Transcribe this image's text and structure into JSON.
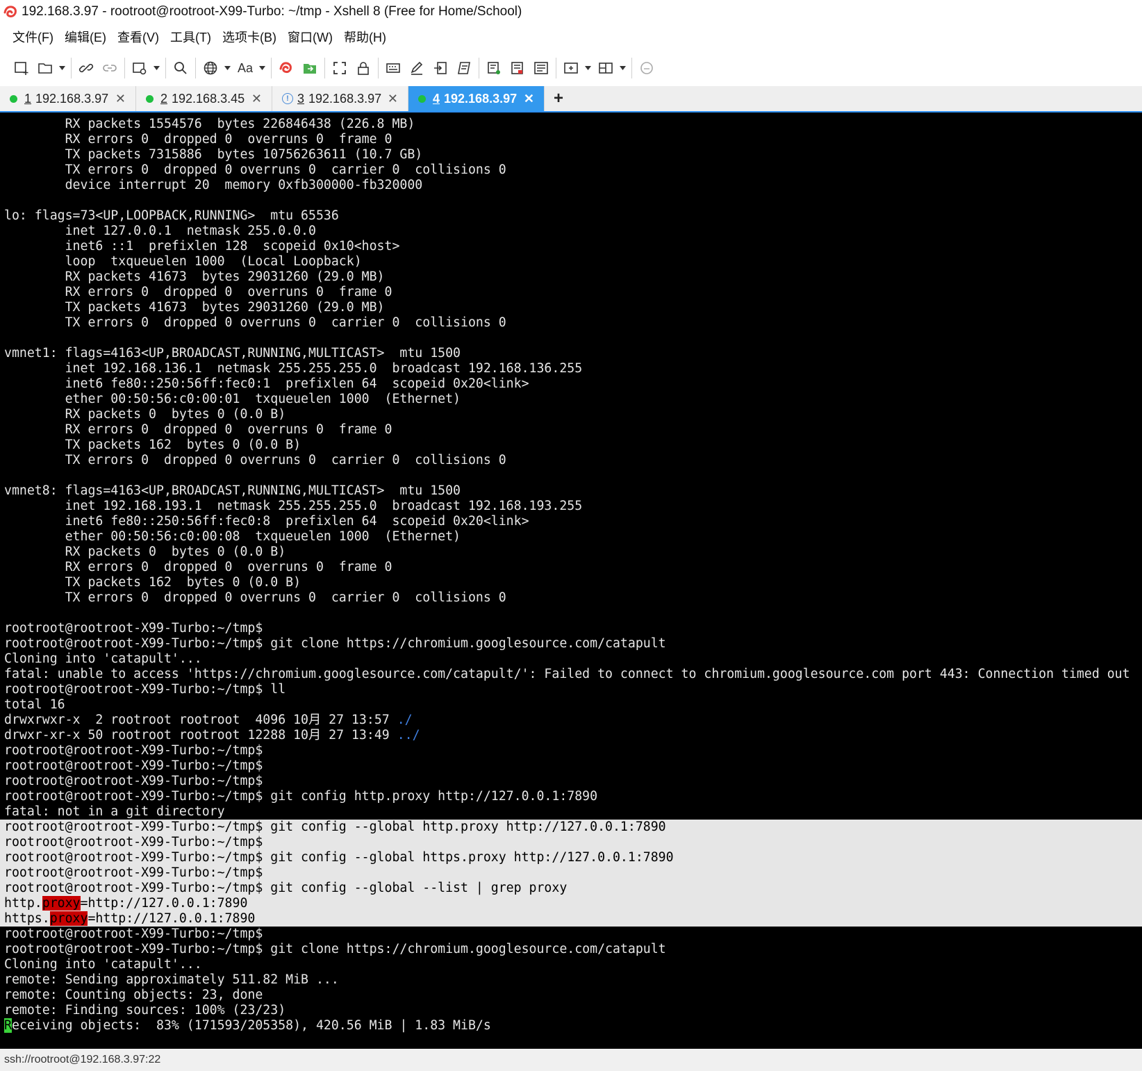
{
  "window": {
    "title": "192.168.3.97 - rootroot@rootroot-X99-Turbo: ~/tmp - Xshell 8 (Free for Home/School)"
  },
  "menu": [
    "文件(F)",
    "编辑(E)",
    "查看(V)",
    "工具(T)",
    "选项卡(B)",
    "窗口(W)",
    "帮助(H)"
  ],
  "toolbar": {
    "font_label": "Aa"
  },
  "tabs": [
    {
      "num": "1",
      "label": "192.168.3.97",
      "status": "connected",
      "active": false
    },
    {
      "num": "2",
      "label": "192.168.3.45",
      "status": "connected",
      "active": false
    },
    {
      "num": "3",
      "label": "192.168.3.97",
      "status": "warning",
      "active": false
    },
    {
      "num": "4",
      "label": "192.168.3.97",
      "status": "connected",
      "active": true
    }
  ],
  "tab_add_label": "+",
  "terminal": {
    "lines": [
      "        RX packets 1554576  bytes 226846438 (226.8 MB)",
      "        RX errors 0  dropped 0  overruns 0  frame 0",
      "        TX packets 7315886  bytes 10756263611 (10.7 GB)",
      "        TX errors 0  dropped 0 overruns 0  carrier 0  collisions 0",
      "        device interrupt 20  memory 0xfb300000-fb320000",
      "",
      "lo: flags=73<UP,LOOPBACK,RUNNING>  mtu 65536",
      "        inet 127.0.0.1  netmask 255.0.0.0",
      "        inet6 ::1  prefixlen 128  scopeid 0x10<host>",
      "        loop  txqueuelen 1000  (Local Loopback)",
      "        RX packets 41673  bytes 29031260 (29.0 MB)",
      "        RX errors 0  dropped 0  overruns 0  frame 0",
      "        TX packets 41673  bytes 29031260 (29.0 MB)",
      "        TX errors 0  dropped 0 overruns 0  carrier 0  collisions 0",
      "",
      "vmnet1: flags=4163<UP,BROADCAST,RUNNING,MULTICAST>  mtu 1500",
      "        inet 192.168.136.1  netmask 255.255.255.0  broadcast 192.168.136.255",
      "        inet6 fe80::250:56ff:fec0:1  prefixlen 64  scopeid 0x20<link>",
      "        ether 00:50:56:c0:00:01  txqueuelen 1000  (Ethernet)",
      "        RX packets 0  bytes 0 (0.0 B)",
      "        RX errors 0  dropped 0  overruns 0  frame 0",
      "        TX packets 162  bytes 0 (0.0 B)",
      "        TX errors 0  dropped 0 overruns 0  carrier 0  collisions 0",
      "",
      "vmnet8: flags=4163<UP,BROADCAST,RUNNING,MULTICAST>  mtu 1500",
      "        inet 192.168.193.1  netmask 255.255.255.0  broadcast 192.168.193.255",
      "        inet6 fe80::250:56ff:fec0:8  prefixlen 64  scopeid 0x20<link>",
      "        ether 00:50:56:c0:00:08  txqueuelen 1000  (Ethernet)",
      "        RX packets 0  bytes 0 (0.0 B)",
      "        RX errors 0  dropped 0  overruns 0  frame 0",
      "        TX packets 162  bytes 0 (0.0 B)",
      "        TX errors 0  dropped 0 overruns 0  carrier 0  collisions 0",
      "",
      "rootroot@rootroot-X99-Turbo:~/tmp$",
      "rootroot@rootroot-X99-Turbo:~/tmp$ git clone https://chromium.googlesource.com/catapult",
      "Cloning into 'catapult'...",
      "fatal: unable to access 'https://chromium.googlesource.com/catapult/': Failed to connect to chromium.googlesource.com port 443: Connection timed out",
      "rootroot@rootroot-X99-Turbo:~/tmp$ ll",
      "total 16",
      "drwxrwxr-x  2 rootroot rootroot  4096 10月 27 13:57 ./",
      "drwxr-xr-x 50 rootroot rootroot 12288 10月 27 13:49 ../",
      "rootroot@rootroot-X99-Turbo:~/tmp$",
      "rootroot@rootroot-X99-Turbo:~/tmp$",
      "rootroot@rootroot-X99-Turbo:~/tmp$",
      "rootroot@rootroot-X99-Turbo:~/tmp$ git config http.proxy http://127.0.0.1:7890",
      "fatal: not in a git directory",
      "rootroot@rootroot-X99-Turbo:~/tmp$ git config --global http.proxy http://127.0.0.1:7890",
      "rootroot@rootroot-X99-Turbo:~/tmp$",
      "rootroot@rootroot-X99-Turbo:~/tmp$ git config --global https.proxy http://127.0.0.1:7890",
      "rootroot@rootroot-X99-Turbo:~/tmp$",
      "rootroot@rootroot-X99-Turbo:~/tmp$ git config --global --list | grep proxy",
      "http.proxy=http://127.0.0.1:7890",
      "https.proxy=http://127.0.0.1:7890",
      "rootroot@rootroot-X99-Turbo:~/tmp$",
      "rootroot@rootroot-X99-Turbo:~/tmp$ git clone https://chromium.googlesource.com/catapult",
      "Cloning into 'catapult'...",
      "remote: Sending approximately 511.82 MiB ...",
      "remote: Counting objects: 23, done",
      "remote: Finding sources: 100% (23/23)",
      "Receiving objects:  83% (171593/205358), 420.56 MiB | 1.83 MiB/s"
    ],
    "selected_range": [
      46,
      52
    ],
    "highlight_word": "proxy",
    "highlight_lines": [
      51,
      52
    ],
    "dir_link_lines": [
      39,
      40
    ],
    "cursor_line": 59,
    "colors": {
      "background": "#000000",
      "text": "#e6e6e6",
      "selection": "#e6e6e6",
      "match_highlight": "#c80000",
      "directory": "#3f7fe0",
      "cursor": "#3ad33a",
      "accent": "#3399ee"
    }
  },
  "status": {
    "connection": "ssh://rootroot@192.168.3.97:22"
  }
}
